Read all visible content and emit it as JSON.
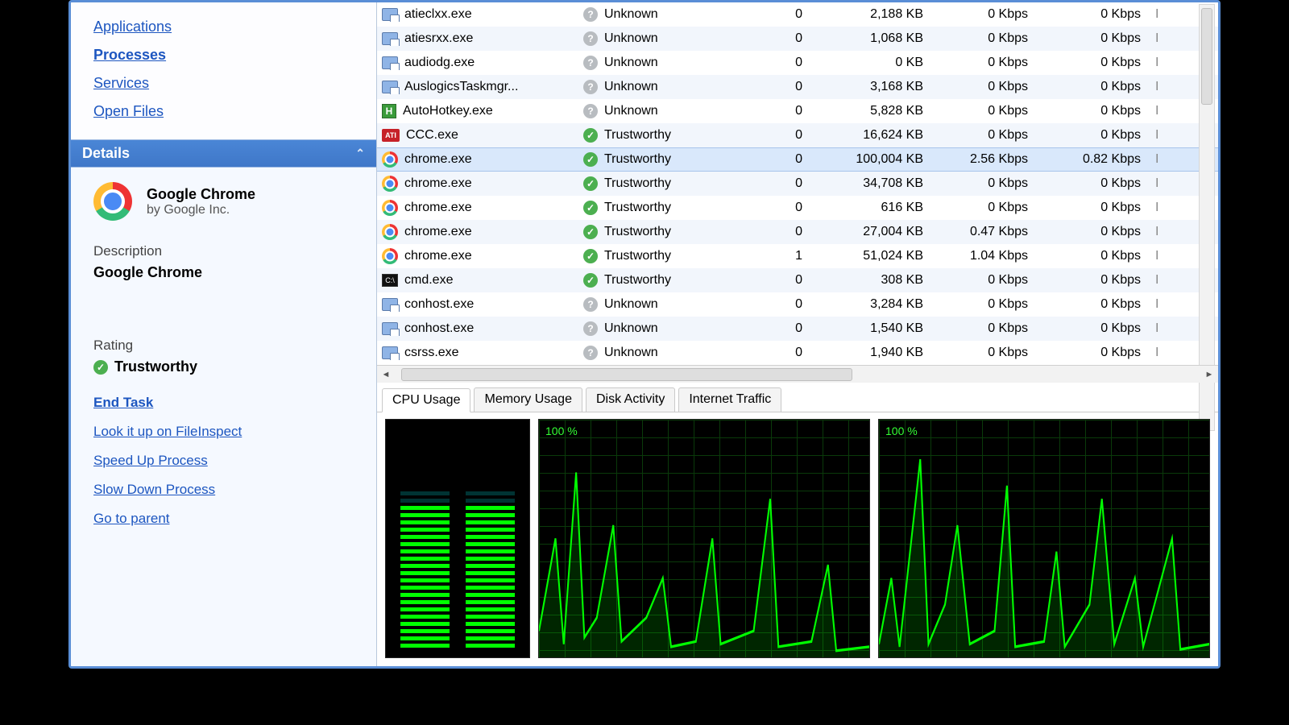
{
  "sidebar": {
    "nav": {
      "applications": "Applications",
      "processes": "Processes",
      "services": "Services",
      "open_files": "Open Files"
    },
    "details": {
      "header": "Details",
      "app_name": "Google Chrome",
      "app_vendor": "by Google Inc.",
      "desc_label": "Description",
      "desc_value": "Google Chrome",
      "rating_label": "Rating",
      "rating_value": "Trustworthy",
      "actions": {
        "end_task": "End Task",
        "lookup": "Look it up on FileInspect",
        "speed_up": "Speed Up Process",
        "slow_down": "Slow Down Process",
        "go_parent": "Go to parent"
      }
    }
  },
  "processes": [
    {
      "icon": "file",
      "name": "atieclxx.exe",
      "rating": "Unknown",
      "ricon": "unk",
      "cpu": "0",
      "mem": "2,188 KB",
      "net": "0 Kbps",
      "net2": "0 Kbps"
    },
    {
      "icon": "file",
      "name": "atiesrxx.exe",
      "rating": "Unknown",
      "ricon": "unk",
      "cpu": "0",
      "mem": "1,068 KB",
      "net": "0 Kbps",
      "net2": "0 Kbps"
    },
    {
      "icon": "file",
      "name": "audiodg.exe",
      "rating": "Unknown",
      "ricon": "unk",
      "cpu": "0",
      "mem": "0 KB",
      "net": "0 Kbps",
      "net2": "0 Kbps"
    },
    {
      "icon": "file",
      "name": "AuslogicsTaskmgr...",
      "rating": "Unknown",
      "ricon": "unk",
      "cpu": "0",
      "mem": "3,168 KB",
      "net": "0 Kbps",
      "net2": "0 Kbps"
    },
    {
      "icon": "ah",
      "name": "AutoHotkey.exe",
      "rating": "Unknown",
      "ricon": "unk",
      "cpu": "0",
      "mem": "5,828 KB",
      "net": "0 Kbps",
      "net2": "0 Kbps"
    },
    {
      "icon": "ati",
      "name": "CCC.exe",
      "rating": "Trustworthy",
      "ricon": "trust",
      "cpu": "0",
      "mem": "16,624 KB",
      "net": "0 Kbps",
      "net2": "0 Kbps"
    },
    {
      "icon": "chrome",
      "name": "chrome.exe",
      "rating": "Trustworthy",
      "ricon": "trust",
      "cpu": "0",
      "mem": "100,004 KB",
      "net": "2.56 Kbps",
      "net2": "0.82 Kbps",
      "selected": true
    },
    {
      "icon": "chrome",
      "name": "chrome.exe",
      "rating": "Trustworthy",
      "ricon": "trust",
      "cpu": "0",
      "mem": "34,708 KB",
      "net": "0 Kbps",
      "net2": "0 Kbps"
    },
    {
      "icon": "chrome",
      "name": "chrome.exe",
      "rating": "Trustworthy",
      "ricon": "trust",
      "cpu": "0",
      "mem": "616 KB",
      "net": "0 Kbps",
      "net2": "0 Kbps"
    },
    {
      "icon": "chrome",
      "name": "chrome.exe",
      "rating": "Trustworthy",
      "ricon": "trust",
      "cpu": "0",
      "mem": "27,004 KB",
      "net": "0.47 Kbps",
      "net2": "0 Kbps"
    },
    {
      "icon": "chrome",
      "name": "chrome.exe",
      "rating": "Trustworthy",
      "ricon": "trust",
      "cpu": "1",
      "mem": "51,024 KB",
      "net": "1.04 Kbps",
      "net2": "0 Kbps"
    },
    {
      "icon": "cmd",
      "name": "cmd.exe",
      "rating": "Trustworthy",
      "ricon": "trust",
      "cpu": "0",
      "mem": "308 KB",
      "net": "0 Kbps",
      "net2": "0 Kbps"
    },
    {
      "icon": "file",
      "name": "conhost.exe",
      "rating": "Unknown",
      "ricon": "unk",
      "cpu": "0",
      "mem": "3,284 KB",
      "net": "0 Kbps",
      "net2": "0 Kbps"
    },
    {
      "icon": "file",
      "name": "conhost.exe",
      "rating": "Unknown",
      "ricon": "unk",
      "cpu": "0",
      "mem": "1,540 KB",
      "net": "0 Kbps",
      "net2": "0 Kbps"
    },
    {
      "icon": "file",
      "name": "csrss.exe",
      "rating": "Unknown",
      "ricon": "unk",
      "cpu": "0",
      "mem": "1,940 KB",
      "net": "0 Kbps",
      "net2": "0 Kbps"
    }
  ],
  "perf_tabs": {
    "cpu": "CPU Usage",
    "mem": "Memory Usage",
    "disk": "Disk Activity",
    "net": "Internet Traffic"
  },
  "chart": {
    "label_100": "100 %"
  }
}
